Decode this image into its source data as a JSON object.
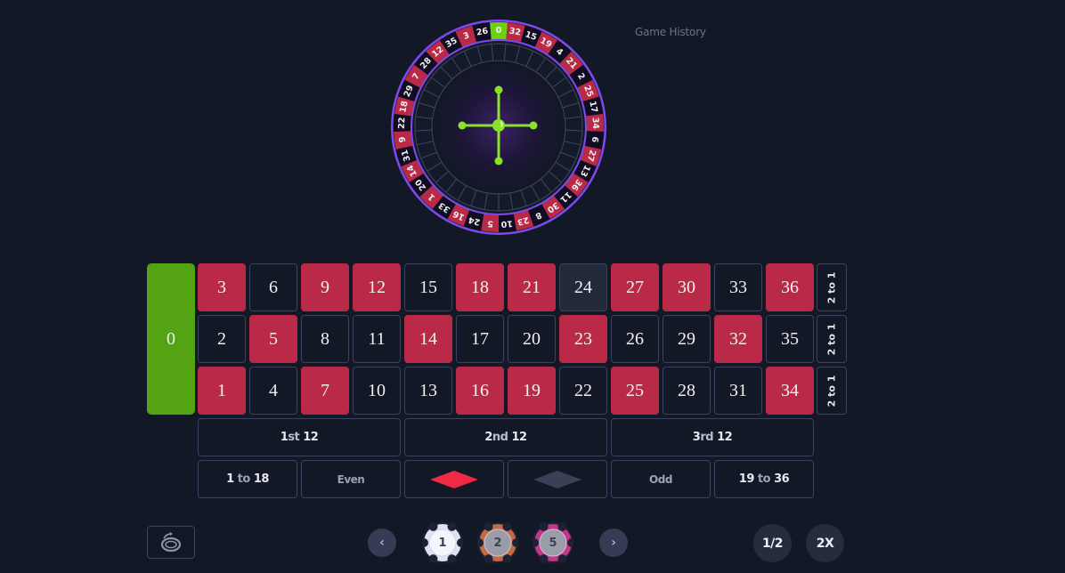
{
  "header": {
    "game_history_label": "Game History"
  },
  "wheel": {
    "pocket_order": [
      0,
      32,
      15,
      19,
      4,
      21,
      2,
      25,
      17,
      34,
      6,
      27,
      13,
      36,
      11,
      30,
      8,
      23,
      10,
      5,
      24,
      16,
      33,
      1,
      20,
      14,
      31,
      9,
      22,
      18,
      29,
      7,
      28,
      12,
      35,
      3,
      26
    ],
    "red_numbers": [
      1,
      3,
      5,
      7,
      9,
      12,
      14,
      16,
      18,
      19,
      21,
      23,
      25,
      27,
      30,
      32,
      34,
      36
    ],
    "colors": {
      "red": "#ba2a46",
      "black": "#100d22",
      "green": "#6bd20f",
      "rim": "#7b4bf0",
      "turret": "#8be22a"
    }
  },
  "board": {
    "zero_label": "0",
    "rows": [
      [
        3,
        6,
        9,
        12,
        15,
        18,
        21,
        24,
        27,
        30,
        33,
        36
      ],
      [
        2,
        5,
        8,
        11,
        14,
        17,
        20,
        23,
        26,
        29,
        32,
        35
      ],
      [
        1,
        4,
        7,
        10,
        13,
        16,
        19,
        22,
        25,
        28,
        31,
        34
      ]
    ],
    "hovered_number": 24,
    "column_bet_label": "2 to 1",
    "dozens": [
      {
        "num": "1",
        "suffix": "st",
        "value": "12"
      },
      {
        "num": "2",
        "suffix": "nd",
        "value": "12"
      },
      {
        "num": "3",
        "suffix": "rd",
        "value": "12"
      }
    ],
    "outside": {
      "low": {
        "from": "1",
        "to_word": "to",
        "to": "18"
      },
      "even": "Even",
      "red_color": "#ee2a44",
      "black_color": "#3a4157",
      "odd": "Odd",
      "high": {
        "from": "19",
        "to_word": "to",
        "to": "36"
      }
    },
    "colors": {
      "red": "#ba2a46",
      "black": "#121826",
      "green": "#53a313"
    }
  },
  "controls": {
    "undo_icon": "undo-rotate-icon",
    "prev_label": "‹",
    "next_label": "›",
    "chips": [
      {
        "value": "1",
        "color": "#dfe4f4",
        "selected": true
      },
      {
        "value": "2",
        "color": "#c46a46",
        "selected": false
      },
      {
        "value": "5",
        "color": "#c43689",
        "selected": false
      }
    ],
    "half_label": "1/2",
    "double_label": "2X"
  }
}
